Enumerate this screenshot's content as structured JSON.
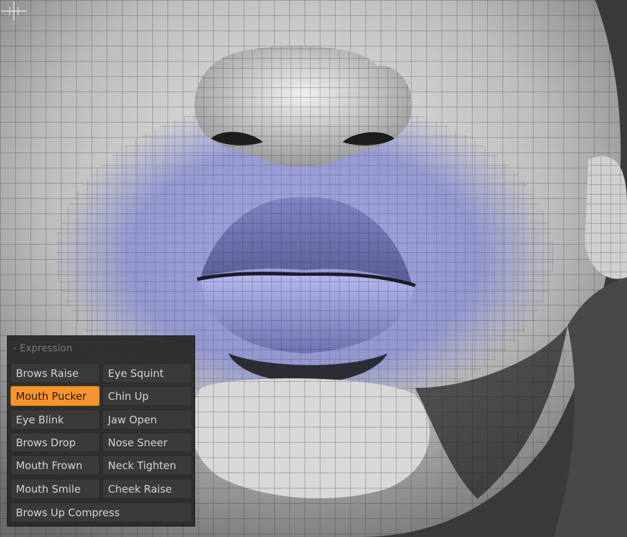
{
  "viewport": {
    "description_icon": "sculpt-face-mesh",
    "mask_color": "#8a8fd0",
    "accent_color": "#f59530"
  },
  "expression_panel": {
    "title": "- Expression",
    "buttons": [
      {
        "label": "Brows Raise",
        "active": false
      },
      {
        "label": "Eye Squint",
        "active": false
      },
      {
        "label": "Mouth Pucker",
        "active": true
      },
      {
        "label": "Chin Up",
        "active": false
      },
      {
        "label": "Eye Blink",
        "active": false
      },
      {
        "label": "Jaw Open",
        "active": false
      },
      {
        "label": "Brows Drop",
        "active": false
      },
      {
        "label": "Nose Sneer",
        "active": false
      },
      {
        "label": "Mouth Frown",
        "active": false
      },
      {
        "label": "Neck Tighten",
        "active": false
      },
      {
        "label": "Mouth Smile",
        "active": false
      },
      {
        "label": "Cheek Raise",
        "active": false
      },
      {
        "label": "Brows Up Compress",
        "active": false
      }
    ]
  }
}
